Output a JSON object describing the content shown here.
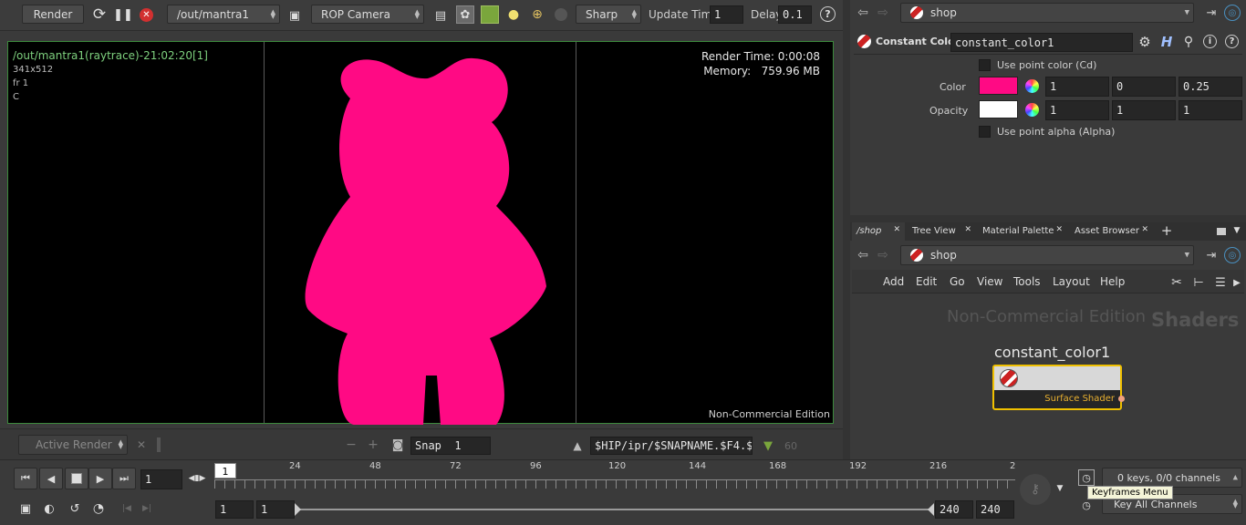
{
  "render_toolbar": {
    "render_label": "Render",
    "rop_path": "/out/mantra1",
    "camera": "ROP Camera",
    "filter": "Sharp",
    "update_time_label": "Update Time",
    "update_time_value": "1",
    "delay_label": "Delay",
    "delay_value": "0.1"
  },
  "viewport": {
    "render_title": "/out/mantra1(raytrace)-21:02:20[1]",
    "resolution": "341x512",
    "frame": "fr 1",
    "channel": "C",
    "render_time": "Render Time: 0:00:08",
    "memory": "Memory:   759.96 MB",
    "watermark": "Non-Commercial Edition",
    "shape_color": "#ff0a84",
    "background_color": "#000000"
  },
  "snapshot_bar": {
    "active_render": "Active Render",
    "snap_value": "Snap  1",
    "snap_path": "$HIP/ipr/$SNAPNAME.$F4.$",
    "snap_count": "60"
  },
  "param_pane": {
    "network": "shop",
    "node_type": "Constant Color",
    "node_name": "constant_color1",
    "use_point_color_label": "Use point color (Cd)",
    "color_label": "Color",
    "color_swatch": "#ff0a84",
    "color_values": [
      "1",
      "0",
      "0.25"
    ],
    "opacity_label": "Opacity",
    "opacity_swatch": "#ffffff",
    "opacity_values": [
      "1",
      "1",
      "1"
    ],
    "use_point_alpha_label": "Use point alpha (Alpha)"
  },
  "network_pane": {
    "tabs": [
      "/shop",
      "Tree View",
      "Material Palette",
      "Asset Browser"
    ],
    "network": "shop",
    "menu": [
      "Add",
      "Edit",
      "Go",
      "View",
      "Tools",
      "Layout",
      "Help"
    ],
    "watermark": "Non-Commercial Edition",
    "context_label": "Shaders",
    "node_title": "constant_color1",
    "node_output": "Surface Shader",
    "node_color": "#f0c000"
  },
  "timeline": {
    "current_frame": "1",
    "frame_marker": "1",
    "ticks": [
      "24",
      "48",
      "72",
      "96",
      "120",
      "144",
      "168",
      "192",
      "216",
      "2"
    ],
    "range_start": "1",
    "range_start2": "1",
    "range_end": "240",
    "range_end2": "240",
    "keys_info": "0 keys, 0/0 channels",
    "key_all_channels": "Key All Channels",
    "tooltip": "Keyframes Menu"
  }
}
